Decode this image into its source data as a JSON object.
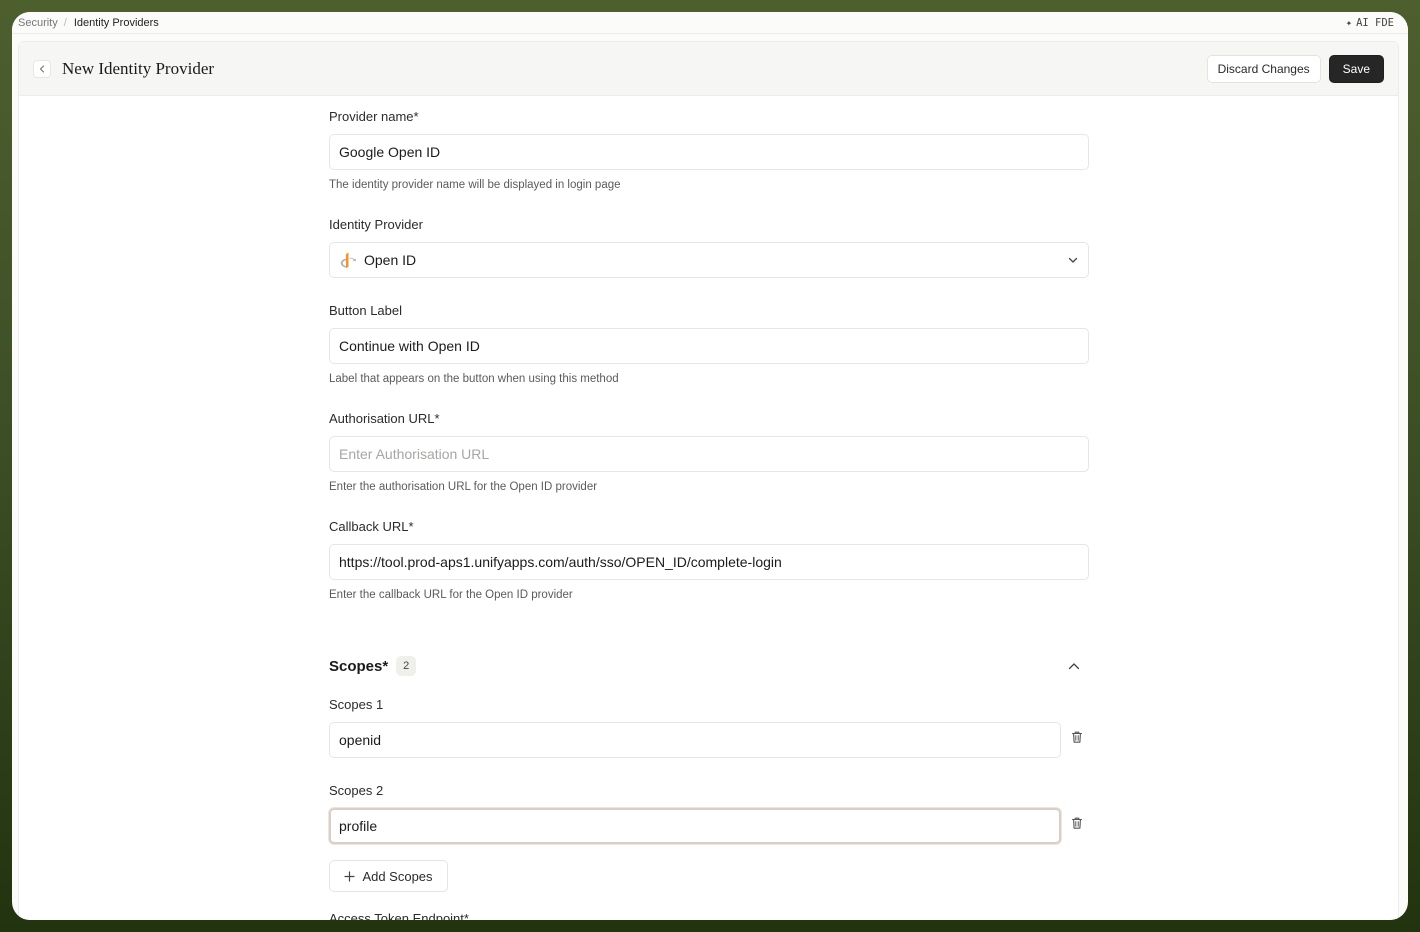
{
  "breadcrumb": {
    "parent": "Security",
    "current": "Identity Providers"
  },
  "assistant": {
    "label": "AI FDE",
    "icon": "sparkle-icon"
  },
  "header": {
    "title": "New Identity Provider",
    "discard_label": "Discard Changes",
    "save_label": "Save"
  },
  "form": {
    "provider_name": {
      "label": "Provider name*",
      "value": "Google Open ID",
      "help": "The identity provider name will be displayed in login page"
    },
    "identity_provider": {
      "label": "Identity Provider",
      "value": "Open ID",
      "icon": "openid-icon"
    },
    "button_label": {
      "label": "Button Label",
      "value": "Continue with Open ID",
      "help": "Label that appears on the button when using this method"
    },
    "authorisation_url": {
      "label": "Authorisation URL*",
      "placeholder": "Enter Authorisation URL",
      "help": "Enter the authorisation URL for the Open ID provider"
    },
    "callback_url": {
      "label": "Callback URL*",
      "value": "https://tool.prod-aps1.unifyapps.com/auth/sso/OPEN_ID/complete-login",
      "help": "Enter the callback URL for the Open ID provider"
    },
    "scopes": {
      "title": "Scopes*",
      "count": "2",
      "items": [
        {
          "label": "Scopes 1",
          "value": "openid"
        },
        {
          "label": "Scopes 2",
          "value": "profile"
        }
      ],
      "add_label": "Add Scopes"
    },
    "access_token_endpoint": {
      "label": "Access Token Endpoint*"
    }
  }
}
